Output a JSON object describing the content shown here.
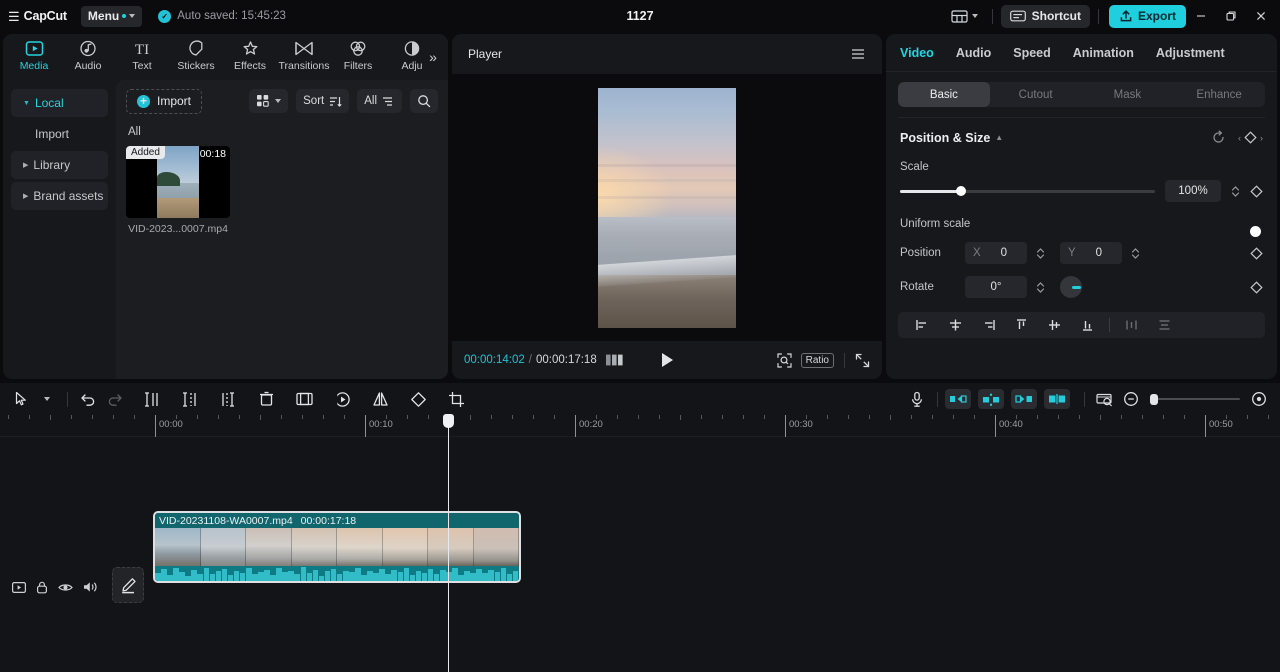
{
  "titlebar": {
    "app_name": "CapCut",
    "menu_label": "Menu",
    "autosave_text": "Auto saved: 15:45:23",
    "project_title": "1127",
    "shortcut_label": "Shortcut",
    "export_label": "Export",
    "layout_icon": "layout-icon",
    "minimize_icon": "minimize-icon",
    "maximize_icon": "maximize-icon",
    "close_icon": "close-icon"
  },
  "media_panel": {
    "tabs": [
      {
        "label": "Media",
        "icon": "media-icon",
        "active": true
      },
      {
        "label": "Audio",
        "icon": "audio-icon",
        "active": false
      },
      {
        "label": "Text",
        "icon": "text-icon",
        "active": false
      },
      {
        "label": "Stickers",
        "icon": "stickers-icon",
        "active": false
      },
      {
        "label": "Effects",
        "icon": "effects-icon",
        "active": false
      },
      {
        "label": "Transitions",
        "icon": "transitions-icon",
        "active": false
      },
      {
        "label": "Filters",
        "icon": "filters-icon",
        "active": false
      },
      {
        "label": "Adju",
        "icon": "adjustment-icon",
        "active": false
      }
    ],
    "more_icon": "chevron-right-double-icon",
    "sidebar": [
      {
        "label": "Local",
        "active": true,
        "expandable": true
      },
      {
        "label": "Import",
        "active": false,
        "expandable": false
      },
      {
        "label": "Library",
        "active": false,
        "expandable": true
      },
      {
        "label": "Brand assets",
        "active": false,
        "expandable": true
      }
    ],
    "toolbar": {
      "import_label": "Import",
      "grid_icon": "grid-view-icon",
      "sort_label": "Sort",
      "filter_all_label": "All",
      "search_icon": "search-icon"
    },
    "section_label": "All",
    "items": [
      {
        "badge": "Added",
        "duration": "00:18",
        "name": "VID-2023...0007.mp4"
      }
    ]
  },
  "player": {
    "title": "Player",
    "menu_icon": "hamburger-icon",
    "current_time": "00:00:14:02",
    "time_separator": "/",
    "total_time": "00:00:17:18",
    "frames_icon": "frames-icon",
    "play_icon": "play-icon",
    "magnify_icon": "magnify-icon",
    "ratio_label": "Ratio",
    "fullscreen_icon": "fullscreen-icon"
  },
  "properties": {
    "tabs": [
      {
        "label": "Video",
        "active": true
      },
      {
        "label": "Audio",
        "active": false
      },
      {
        "label": "Speed",
        "active": false
      },
      {
        "label": "Animation",
        "active": false
      },
      {
        "label": "Adjustment",
        "active": false
      }
    ],
    "segments": [
      {
        "label": "Basic",
        "active": true,
        "enabled": true
      },
      {
        "label": "Cutout",
        "active": false,
        "enabled": true
      },
      {
        "label": "Mask",
        "active": false,
        "enabled": false
      },
      {
        "label": "Enhance",
        "active": false,
        "enabled": false
      }
    ],
    "section_title": "Position & Size",
    "reset_icon": "reset-icon",
    "keyframe_icon": "keyframe-diamond-icon",
    "scale": {
      "label": "Scale",
      "value": "100%",
      "slider_percent": 24
    },
    "uniform_scale": {
      "label": "Uniform scale",
      "enabled": true
    },
    "position": {
      "label": "Position",
      "x_axis": "X",
      "x_value": "0",
      "y_axis": "Y",
      "y_value": "0"
    },
    "rotate": {
      "label": "Rotate",
      "value": "0°"
    },
    "align_buttons": [
      "align-left-icon",
      "align-center-horizontal-icon",
      "align-right-icon",
      "align-top-icon",
      "align-center-vertical-icon",
      "align-bottom-icon",
      "distribute-horizontal-icon",
      "distribute-vertical-icon"
    ]
  },
  "timeline": {
    "toolbar_left": [
      "select-tool-icon",
      "tool-dropdown-icon",
      "undo-icon",
      "redo-icon",
      "split-icon",
      "trim-left-icon",
      "trim-right-icon",
      "delete-icon",
      "crop-frame-icon",
      "speed-icon",
      "mirror-icon",
      "rotate-icon",
      "crop-icon"
    ],
    "toolbar_right": [
      "microphone-icon",
      "clip-left-icon",
      "clip-expand-icon",
      "clip-right-icon",
      "clip-split-icon",
      "thumbnail-icon",
      "zoom-out-icon",
      "zoom-in-icon"
    ],
    "ruler_labels": [
      "00:00",
      "00:10",
      "00:20",
      "00:30",
      "00:40",
      "00:50"
    ],
    "track_head_icons": [
      "video-track-icon",
      "lock-icon",
      "eye-icon",
      "speaker-icon"
    ],
    "edit_icon": "pencil-edit-icon",
    "clip": {
      "name": "VID-20231108-WA0007.mp4",
      "duration": "00:00:17:18"
    },
    "zoom_slider_percent": 0
  },
  "colors": {
    "accent": "#1fcfdd",
    "accent_text": "#25d4e2",
    "clip_teal": "#11666e",
    "panel_bg": "#17181c",
    "app_bg": "#0b0b0d"
  }
}
